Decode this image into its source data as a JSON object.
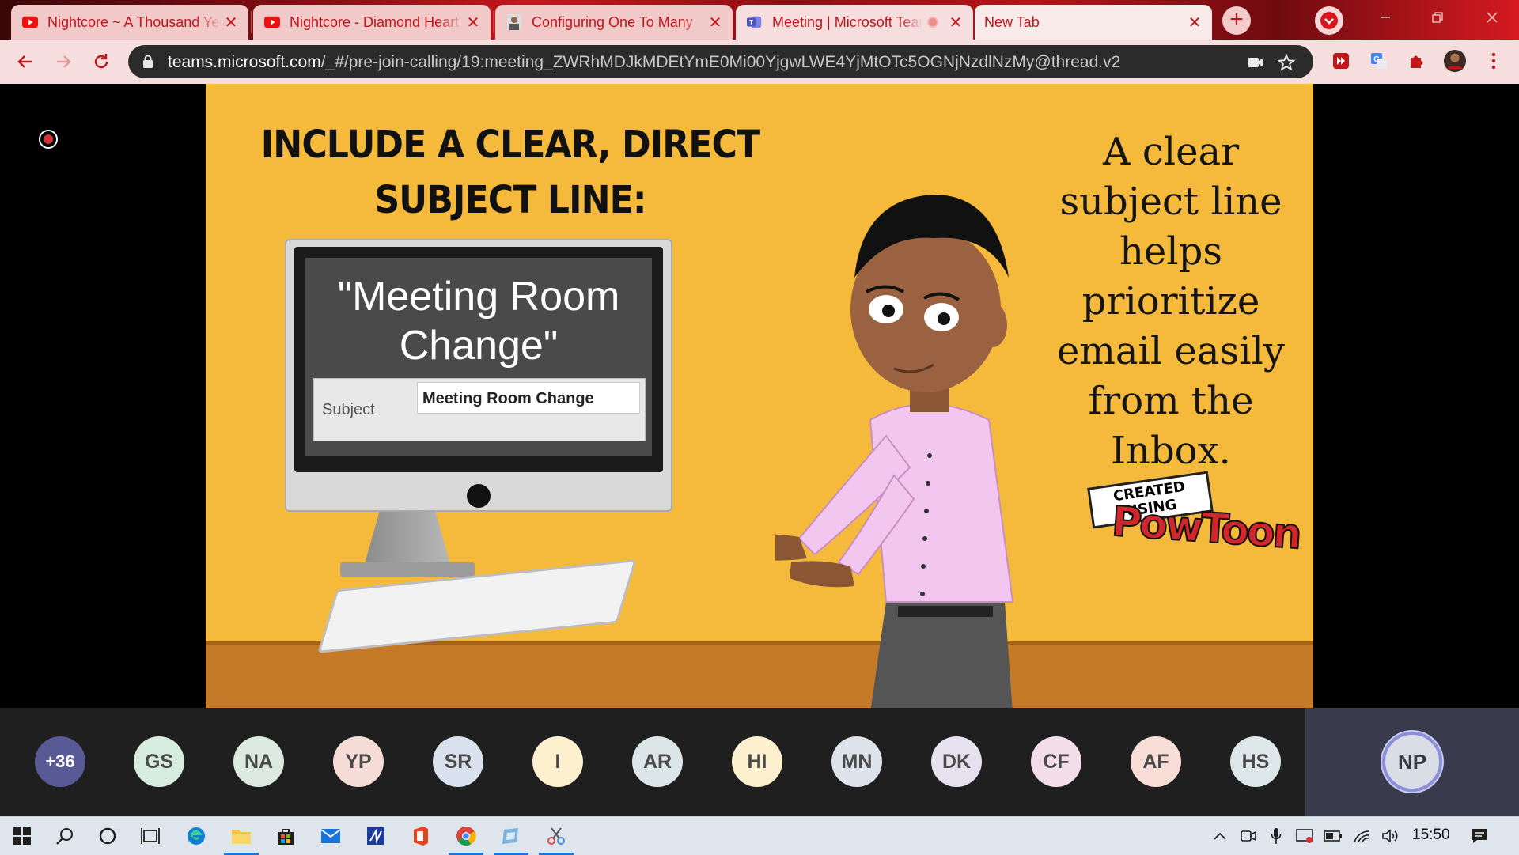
{
  "browser": {
    "tabs": [
      {
        "title": "Nightcore ~ A Thousand Years",
        "favicon": "youtube-icon"
      },
      {
        "title": "Nightcore - Diamond Heart",
        "favicon": "youtube-icon"
      },
      {
        "title": "Configuring One To Many",
        "favicon": "person-thumbnail-icon"
      },
      {
        "title": "Meeting | Microsoft Teams",
        "favicon": "teams-icon",
        "active": true,
        "recording": true
      },
      {
        "title": "New Tab",
        "favicon": ""
      }
    ],
    "close_glyph": "✕",
    "new_tab_glyph": "+",
    "address": {
      "host": "teams.microsoft.com",
      "path": "/_#/pre-join-calling/19:meeting_ZWRhMDJkMDEtYmE0Mi00YjgwLWE4YjMtOTc5OGNjNzdlNzMy@thread.v2"
    }
  },
  "slide": {
    "heading_line1": "Include a clear, direct",
    "heading_line2": "subject line:",
    "screen_title_line1": "\"Meeting Room",
    "screen_title_line2": "Change\"",
    "subject_label": "Subject",
    "subject_value": "Meeting Room Change",
    "side_text_lines": [
      "A clear",
      "subject line",
      "helps",
      "prioritize",
      "email easily",
      "from the",
      "Inbox."
    ],
    "watermark_top": "CREATED USING",
    "watermark_brand": "PowToon"
  },
  "participants": {
    "more": "+36",
    "people": [
      {
        "initials": "GS",
        "color": "#d6ecdf"
      },
      {
        "initials": "NA",
        "color": "#dbe9e1"
      },
      {
        "initials": "YP",
        "color": "#f6dcd6"
      },
      {
        "initials": "SR",
        "color": "#d9e0ee"
      },
      {
        "initials": "I",
        "color": "#fdf0cf"
      },
      {
        "initials": "AR",
        "color": "#dce6e8"
      },
      {
        "initials": "HI",
        "color": "#fdf0cf"
      },
      {
        "initials": "MN",
        "color": "#dde3ea"
      },
      {
        "initials": "DK",
        "color": "#e6e1ef"
      },
      {
        "initials": "CF",
        "color": "#f3dde9"
      },
      {
        "initials": "AF",
        "color": "#f7ddd6"
      },
      {
        "initials": "HS",
        "color": "#dde7ea"
      }
    ],
    "self": "NP"
  },
  "taskbar": {
    "time": "15:50"
  }
}
